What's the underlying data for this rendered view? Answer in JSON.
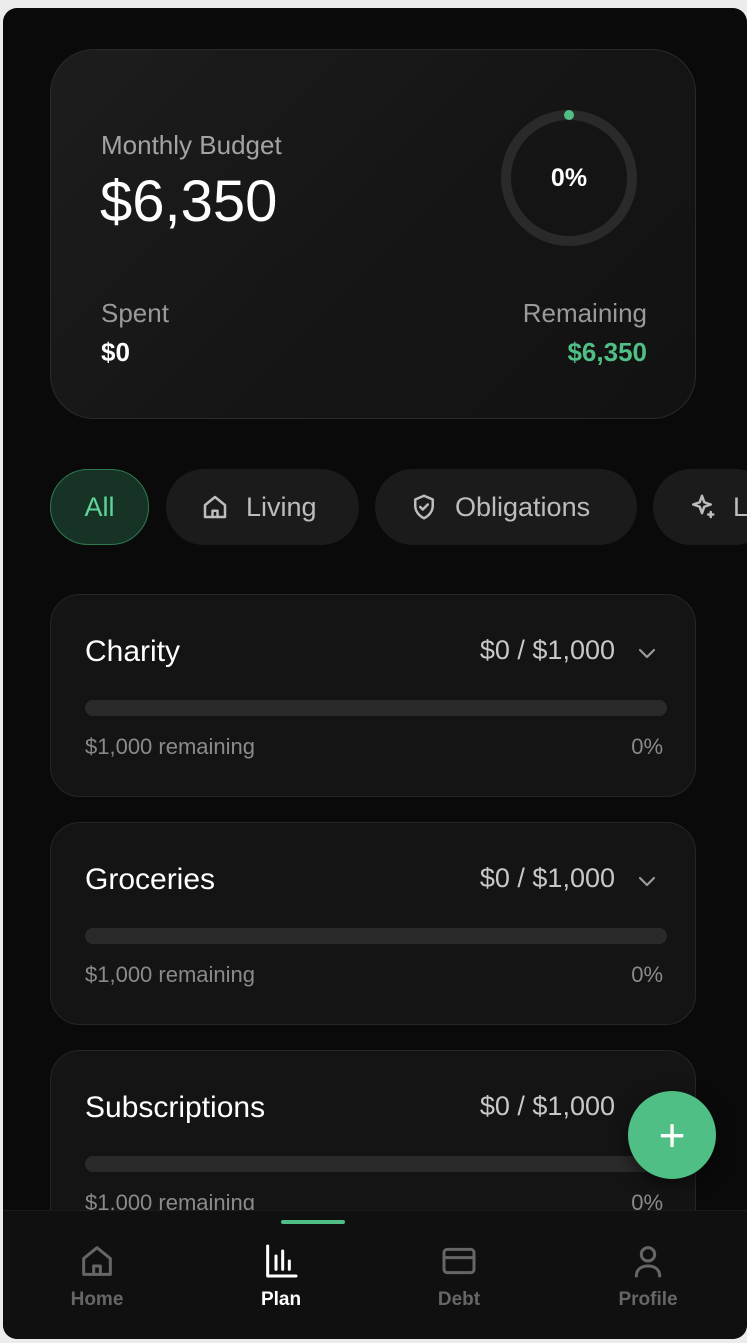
{
  "budget": {
    "label": "Monthly Budget",
    "amount": "$6,350",
    "percent_text": "0%",
    "percent_used": 0,
    "spent_label": "Spent",
    "spent_value": "$0",
    "remaining_label": "Remaining",
    "remaining_value": "$6,350"
  },
  "filters": [
    {
      "label": "All",
      "icon": "none",
      "active": true
    },
    {
      "label": "Living",
      "icon": "home-icon",
      "active": false
    },
    {
      "label": "Obligations",
      "icon": "shield-check-icon",
      "active": false
    },
    {
      "label": "L",
      "icon": "sparkles-icon",
      "active": false
    }
  ],
  "categories": [
    {
      "name": "Charity",
      "amount": "$0 / $1,000",
      "remaining": "$1,000 remaining",
      "percent": "0%",
      "progress": 0
    },
    {
      "name": "Groceries",
      "amount": "$0 / $1,000",
      "remaining": "$1,000 remaining",
      "percent": "0%",
      "progress": 0
    },
    {
      "name": "Subscriptions",
      "amount": "$0 / $1,000",
      "remaining": "$1,000 remaining",
      "percent": "0%",
      "progress": 0
    }
  ],
  "fab": {
    "icon": "plus-icon",
    "symbol": "+"
  },
  "nav": {
    "items": [
      {
        "label": "Home",
        "icon": "home-icon",
        "active": false
      },
      {
        "label": "Plan",
        "icon": "bar-chart-icon",
        "active": true
      },
      {
        "label": "Debt",
        "icon": "credit-card-icon",
        "active": false
      },
      {
        "label": "Profile",
        "icon": "user-icon",
        "active": false
      }
    ]
  },
  "colors": {
    "accent": "#4fbf86",
    "background": "#0a0a0a",
    "card": "#141414"
  }
}
